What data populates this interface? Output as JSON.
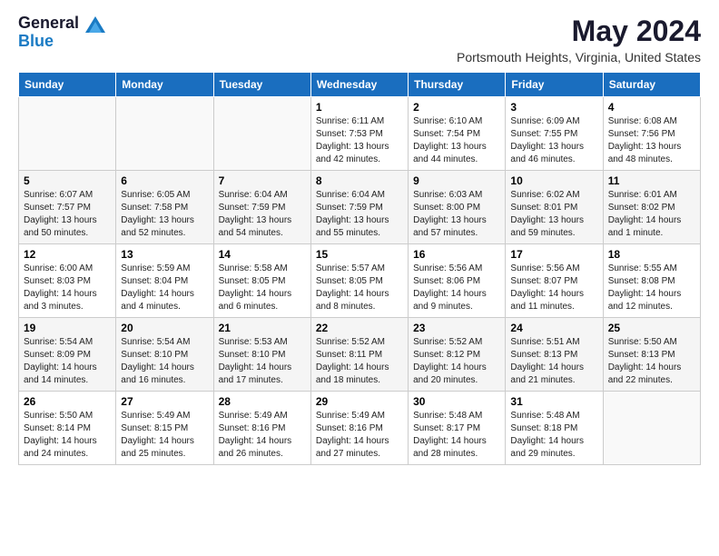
{
  "logo": {
    "general": "General",
    "blue": "Blue"
  },
  "header": {
    "month": "May 2024",
    "location": "Portsmouth Heights, Virginia, United States"
  },
  "weekdays": [
    "Sunday",
    "Monday",
    "Tuesday",
    "Wednesday",
    "Thursday",
    "Friday",
    "Saturday"
  ],
  "weeks": [
    [
      {
        "day": "",
        "info": ""
      },
      {
        "day": "",
        "info": ""
      },
      {
        "day": "",
        "info": ""
      },
      {
        "day": "1",
        "info": "Sunrise: 6:11 AM\nSunset: 7:53 PM\nDaylight: 13 hours\nand 42 minutes."
      },
      {
        "day": "2",
        "info": "Sunrise: 6:10 AM\nSunset: 7:54 PM\nDaylight: 13 hours\nand 44 minutes."
      },
      {
        "day": "3",
        "info": "Sunrise: 6:09 AM\nSunset: 7:55 PM\nDaylight: 13 hours\nand 46 minutes."
      },
      {
        "day": "4",
        "info": "Sunrise: 6:08 AM\nSunset: 7:56 PM\nDaylight: 13 hours\nand 48 minutes."
      }
    ],
    [
      {
        "day": "5",
        "info": "Sunrise: 6:07 AM\nSunset: 7:57 PM\nDaylight: 13 hours\nand 50 minutes."
      },
      {
        "day": "6",
        "info": "Sunrise: 6:05 AM\nSunset: 7:58 PM\nDaylight: 13 hours\nand 52 minutes."
      },
      {
        "day": "7",
        "info": "Sunrise: 6:04 AM\nSunset: 7:59 PM\nDaylight: 13 hours\nand 54 minutes."
      },
      {
        "day": "8",
        "info": "Sunrise: 6:04 AM\nSunset: 7:59 PM\nDaylight: 13 hours\nand 55 minutes."
      },
      {
        "day": "9",
        "info": "Sunrise: 6:03 AM\nSunset: 8:00 PM\nDaylight: 13 hours\nand 57 minutes."
      },
      {
        "day": "10",
        "info": "Sunrise: 6:02 AM\nSunset: 8:01 PM\nDaylight: 13 hours\nand 59 minutes."
      },
      {
        "day": "11",
        "info": "Sunrise: 6:01 AM\nSunset: 8:02 PM\nDaylight: 14 hours\nand 1 minute."
      }
    ],
    [
      {
        "day": "12",
        "info": "Sunrise: 6:00 AM\nSunset: 8:03 PM\nDaylight: 14 hours\nand 3 minutes."
      },
      {
        "day": "13",
        "info": "Sunrise: 5:59 AM\nSunset: 8:04 PM\nDaylight: 14 hours\nand 4 minutes."
      },
      {
        "day": "14",
        "info": "Sunrise: 5:58 AM\nSunset: 8:05 PM\nDaylight: 14 hours\nand 6 minutes."
      },
      {
        "day": "15",
        "info": "Sunrise: 5:57 AM\nSunset: 8:05 PM\nDaylight: 14 hours\nand 8 minutes."
      },
      {
        "day": "16",
        "info": "Sunrise: 5:56 AM\nSunset: 8:06 PM\nDaylight: 14 hours\nand 9 minutes."
      },
      {
        "day": "17",
        "info": "Sunrise: 5:56 AM\nSunset: 8:07 PM\nDaylight: 14 hours\nand 11 minutes."
      },
      {
        "day": "18",
        "info": "Sunrise: 5:55 AM\nSunset: 8:08 PM\nDaylight: 14 hours\nand 12 minutes."
      }
    ],
    [
      {
        "day": "19",
        "info": "Sunrise: 5:54 AM\nSunset: 8:09 PM\nDaylight: 14 hours\nand 14 minutes."
      },
      {
        "day": "20",
        "info": "Sunrise: 5:54 AM\nSunset: 8:10 PM\nDaylight: 14 hours\nand 16 minutes."
      },
      {
        "day": "21",
        "info": "Sunrise: 5:53 AM\nSunset: 8:10 PM\nDaylight: 14 hours\nand 17 minutes."
      },
      {
        "day": "22",
        "info": "Sunrise: 5:52 AM\nSunset: 8:11 PM\nDaylight: 14 hours\nand 18 minutes."
      },
      {
        "day": "23",
        "info": "Sunrise: 5:52 AM\nSunset: 8:12 PM\nDaylight: 14 hours\nand 20 minutes."
      },
      {
        "day": "24",
        "info": "Sunrise: 5:51 AM\nSunset: 8:13 PM\nDaylight: 14 hours\nand 21 minutes."
      },
      {
        "day": "25",
        "info": "Sunrise: 5:50 AM\nSunset: 8:13 PM\nDaylight: 14 hours\nand 22 minutes."
      }
    ],
    [
      {
        "day": "26",
        "info": "Sunrise: 5:50 AM\nSunset: 8:14 PM\nDaylight: 14 hours\nand 24 minutes."
      },
      {
        "day": "27",
        "info": "Sunrise: 5:49 AM\nSunset: 8:15 PM\nDaylight: 14 hours\nand 25 minutes."
      },
      {
        "day": "28",
        "info": "Sunrise: 5:49 AM\nSunset: 8:16 PM\nDaylight: 14 hours\nand 26 minutes."
      },
      {
        "day": "29",
        "info": "Sunrise: 5:49 AM\nSunset: 8:16 PM\nDaylight: 14 hours\nand 27 minutes."
      },
      {
        "day": "30",
        "info": "Sunrise: 5:48 AM\nSunset: 8:17 PM\nDaylight: 14 hours\nand 28 minutes."
      },
      {
        "day": "31",
        "info": "Sunrise: 5:48 AM\nSunset: 8:18 PM\nDaylight: 14 hours\nand 29 minutes."
      },
      {
        "day": "",
        "info": ""
      }
    ]
  ]
}
